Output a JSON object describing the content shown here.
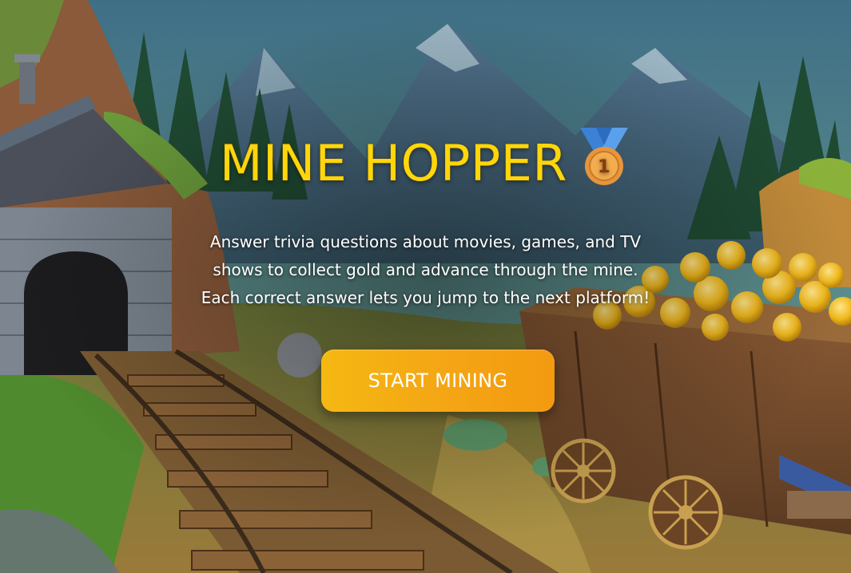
{
  "game": {
    "title": "MINE HOPPER",
    "medal_icon": "first-place-medal-icon",
    "medal_number": "1",
    "description_lines": [
      "Answer trivia questions about movies, games, and TV",
      "shows to collect gold and advance through the mine.",
      "Each correct answer lets you jump to the next platform!"
    ],
    "start_button_label": "START MINING"
  },
  "colors": {
    "title": "#ffd60a",
    "button_start": "#f5b812",
    "button_end": "#f39a10",
    "text": "#ffffff"
  }
}
